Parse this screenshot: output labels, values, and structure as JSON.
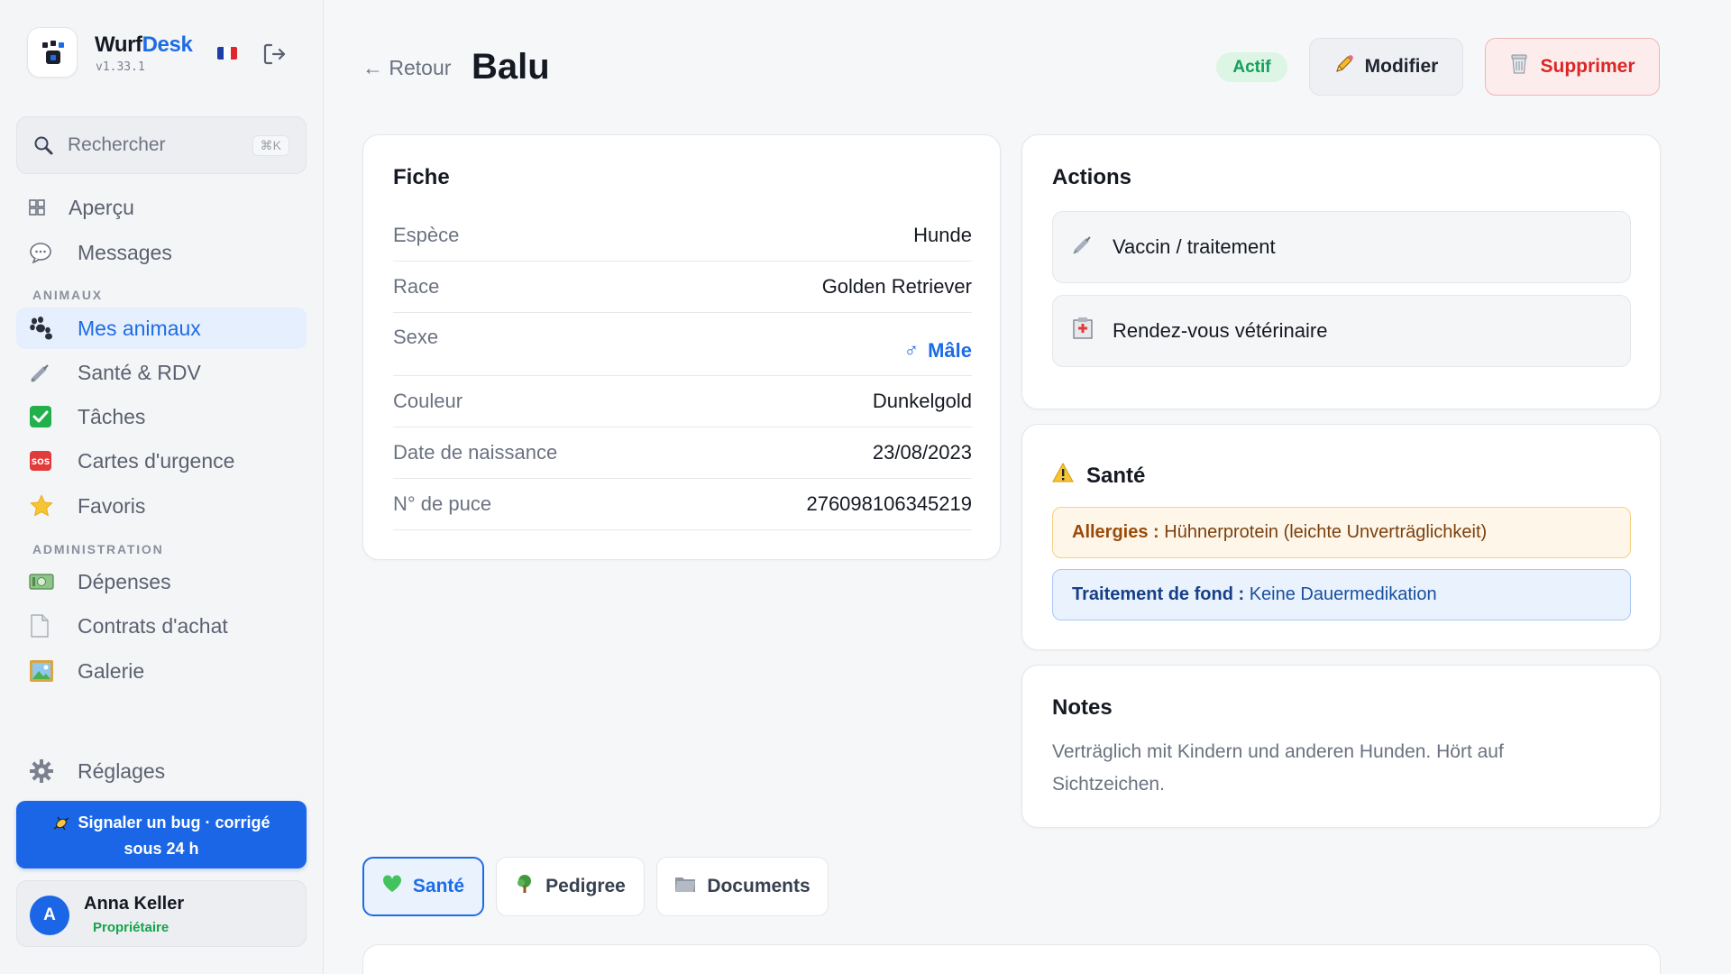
{
  "brand": {
    "name_part1": "Wurf",
    "name_part2": "Desk",
    "version": "v1.33.1",
    "accent_color": "#1d6ce6"
  },
  "sidebar": {
    "search": {
      "placeholder": "Rechercher",
      "shortcut": "⌘K"
    },
    "items_top": [
      {
        "label": "Aperçu",
        "icon": "grid-icon"
      },
      {
        "label": "Messages",
        "icon": "speech-bubble-icon"
      }
    ],
    "section_animaux": "ANIMAUX",
    "items_animaux": [
      {
        "label": "Mes animaux",
        "icon": "paw-icon",
        "active": true
      },
      {
        "label": "Santé & RDV",
        "icon": "syringe-icon"
      },
      {
        "label": "Tâches",
        "icon": "checkbox-icon"
      },
      {
        "label": "Cartes d'urgence",
        "icon": "sos-icon"
      },
      {
        "label": "Favoris",
        "icon": "star-icon"
      }
    ],
    "section_admin": "ADMINISTRATION",
    "items_admin": [
      {
        "label": "Dépenses",
        "icon": "money-icon"
      },
      {
        "label": "Contrats d'achat",
        "icon": "document-icon"
      },
      {
        "label": "Galerie",
        "icon": "picture-icon"
      }
    ],
    "settings": {
      "label": "Réglages",
      "icon": "gear-icon"
    },
    "bug_button": {
      "line1": "Signaler un bug · corrigé",
      "line2": "sous 24 h"
    },
    "user": {
      "initial": "A",
      "name": "Anna Keller",
      "role": "Propriétaire"
    }
  },
  "header": {
    "back_label": "Retour",
    "title": "Balu",
    "status": "Actif",
    "edit_label": "Modifier",
    "delete_label": "Supprimer"
  },
  "fiche": {
    "title": "Fiche",
    "rows": [
      {
        "key": "Espèce",
        "value": "Hunde"
      },
      {
        "key": "Race",
        "value": "Golden Retriever"
      },
      {
        "key": "Sexe",
        "value": "Mâle",
        "symbol": "♂"
      },
      {
        "key": "Couleur",
        "value": "Dunkelgold"
      },
      {
        "key": "Date de naissance",
        "value": "23/08/2023"
      },
      {
        "key": "N° de puce",
        "value": "276098106345219"
      }
    ]
  },
  "actions": {
    "title": "Actions",
    "items": [
      {
        "label": "Vaccin / traitement",
        "icon": "syringe-icon"
      },
      {
        "label": "Rendez-vous vétérinaire",
        "icon": "hospital-icon"
      }
    ]
  },
  "sante": {
    "title": "Santé",
    "allergy_label": "Allergies :",
    "allergy_value": "Hühnerprotein (leichte Unverträglichkeit)",
    "treatment_label": "Traitement de fond :",
    "treatment_value": "Keine Dauermedikation"
  },
  "notes": {
    "title": "Notes",
    "text": "Verträglich mit Kindern und anderen Hunden. Hört auf Sichtzeichen."
  },
  "tabs": [
    {
      "label": "Santé",
      "icon": "green-heart-icon",
      "active": true
    },
    {
      "label": "Pedigree",
      "icon": "tree-icon"
    },
    {
      "label": "Documents",
      "icon": "folder-icon"
    }
  ]
}
